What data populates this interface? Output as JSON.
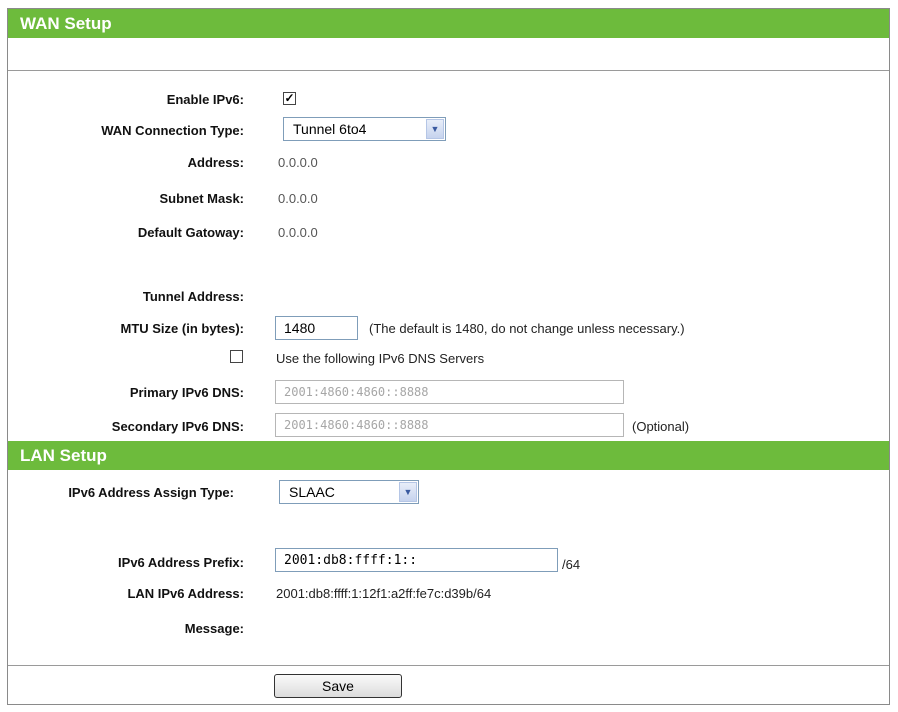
{
  "wan": {
    "title": "WAN Setup",
    "enable_ipv6_label": "Enable IPv6:",
    "enable_ipv6_mark": "✓",
    "conn_type_label": "WAN Connection Type:",
    "conn_type_value": "Tunnel 6to4",
    "address_label": "Address:",
    "address_value": "0.0.0.0",
    "subnet_label": "Subnet Mask:",
    "subnet_value": "0.0.0.0",
    "gateway_label": "Default Gatoway:",
    "gateway_value": "0.0.0.0",
    "tunnel_label": "Tunnel Address:",
    "mtu_label": "MTU Size (in bytes):",
    "mtu_value": "1480",
    "mtu_hint": "(The default is 1480, do not change unless necessary.)",
    "dns_toggle_label": "Use the following IPv6 DNS Servers",
    "primary_dns_label": "Primary IPv6 DNS:",
    "primary_dns_value": "2001:4860:4860::8888",
    "secondary_dns_label": "Secondary IPv6 DNS:",
    "secondary_dns_value": "2001:4860:4860::8888",
    "optional_note": "(Optional)"
  },
  "lan": {
    "title": "LAN Setup",
    "assign_label": "IPv6 Address Assign Type:",
    "assign_value": "SLAAC",
    "prefix_label": "IPv6 Address Prefix:",
    "prefix_value": "2001:db8:ffff:1::",
    "prefix_suffix": "/64",
    "lan_addr_label": "LAN IPv6 Address:",
    "lan_addr_value": "2001:db8:ffff:1:12f1:a2ff:fe7c:d39b/64",
    "message_label": "Message:"
  },
  "actions": {
    "save_label": "Save"
  },
  "colors": {
    "header_bar": "#6dbb3c"
  }
}
